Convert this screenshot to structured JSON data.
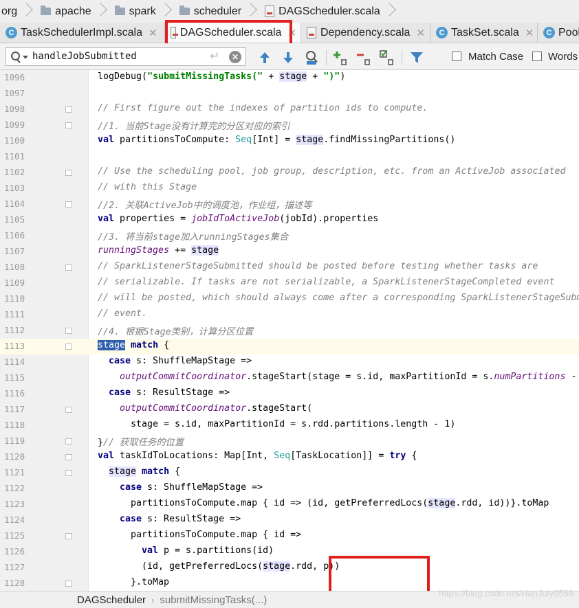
{
  "breadcrumb": [
    "org",
    "apache",
    "spark",
    "scheduler",
    "DAGScheduler.scala"
  ],
  "tabs": [
    {
      "label": "TaskSchedulerImpl.scala",
      "icon": "class-icon"
    },
    {
      "label": "DAGScheduler.scala",
      "icon": "scala-file-icon",
      "active": true
    },
    {
      "label": "Dependency.scala",
      "icon": "scala-file-icon"
    },
    {
      "label": "TaskSet.scala",
      "icon": "class-icon"
    },
    {
      "label": "Pool",
      "icon": "class-icon"
    }
  ],
  "search": {
    "value": "handleJobSubmitted",
    "enter_glyph": "↵",
    "clear_glyph": "✕",
    "match_case_label": "Match Case",
    "words_label": "Words"
  },
  "editor": {
    "lines": [
      {
        "n": "1096",
        "indent": 0,
        "tokens": [
          [
            "logDebug("
          ],
          [
            "\"submitMissingTasks(\"",
            "str"
          ],
          [
            " + "
          ],
          [
            "stage",
            "hl"
          ],
          [
            " + "
          ],
          [
            "\")\"",
            "str"
          ],
          [
            ")"
          ]
        ]
      },
      {
        "n": "1097",
        "indent": 0,
        "tokens": []
      },
      {
        "n": "1098",
        "indent": 0,
        "fold": true,
        "tokens": [
          [
            "// First figure out the indexes of partition ids to compute.",
            "cmt"
          ]
        ]
      },
      {
        "n": "1099",
        "indent": 0,
        "fold": true,
        "tokens": [
          [
            "//1. 当前Stage没有计算完的分区对应的索引",
            "cmt"
          ]
        ]
      },
      {
        "n": "1100",
        "indent": 0,
        "tokens": [
          [
            "val",
            "kw"
          ],
          [
            " partitionsToCompute: "
          ],
          [
            "Seq",
            "typ"
          ],
          [
            "[Int] = "
          ],
          [
            "stage",
            "hl"
          ],
          [
            ".findMissingPartitions()"
          ]
        ]
      },
      {
        "n": "1101",
        "indent": 0,
        "tokens": []
      },
      {
        "n": "1102",
        "indent": 0,
        "fold": true,
        "tokens": [
          [
            "// Use the scheduling pool, job group, description, etc. from an ActiveJob associated",
            "cmt"
          ]
        ]
      },
      {
        "n": "1103",
        "indent": 0,
        "tokens": [
          [
            "// with this Stage",
            "cmt"
          ]
        ]
      },
      {
        "n": "1104",
        "indent": 0,
        "fold": true,
        "tokens": [
          [
            "//2. 关联ActiveJob中的调度池，作业组，描述等",
            "cmt"
          ]
        ]
      },
      {
        "n": "1105",
        "indent": 0,
        "tokens": [
          [
            "val",
            "kw"
          ],
          [
            " properties = "
          ],
          [
            "jobIdToActiveJob",
            "fld"
          ],
          [
            "(jobId).properties"
          ]
        ]
      },
      {
        "n": "1106",
        "indent": 0,
        "tokens": [
          [
            "//3. 将当前stage加入runningStages集合",
            "cmt"
          ]
        ]
      },
      {
        "n": "1107",
        "indent": 0,
        "tokens": [
          [
            "runningStages",
            "fld"
          ],
          [
            " += "
          ],
          [
            "stage",
            "hl"
          ]
        ]
      },
      {
        "n": "1108",
        "indent": 0,
        "fold": true,
        "tokens": [
          [
            "// SparkListenerStageSubmitted should be posted before testing whether tasks are",
            "cmt"
          ]
        ]
      },
      {
        "n": "1109",
        "indent": 0,
        "tokens": [
          [
            "// serializable. If tasks are not serializable, a SparkListenerStageCompleted event",
            "cmt"
          ]
        ]
      },
      {
        "n": "1110",
        "indent": 0,
        "tokens": [
          [
            "// will be posted, which should always come after a corresponding SparkListenerStageSubm",
            "cmt"
          ]
        ]
      },
      {
        "n": "1111",
        "indent": 0,
        "tokens": [
          [
            "// event.",
            "cmt"
          ]
        ]
      },
      {
        "n": "1112",
        "indent": 0,
        "fold": true,
        "tokens": [
          [
            "//4. 根据Stage类别，计算分区位置",
            "cmt"
          ]
        ]
      },
      {
        "n": "1113",
        "indent": 0,
        "fold": true,
        "current": true,
        "tokens": [
          [
            "stage",
            "hl-sel"
          ],
          [
            " "
          ],
          [
            "match",
            "kw"
          ],
          [
            " {"
          ]
        ]
      },
      {
        "n": "1114",
        "indent": 1,
        "tokens": [
          [
            "case",
            "kw"
          ],
          [
            " s: ShuffleMapStage =>"
          ]
        ]
      },
      {
        "n": "1115",
        "indent": 2,
        "tokens": [
          [
            "outputCommitCoordinator",
            "fld"
          ],
          [
            ".stageStart(stage = s.id, maxPartitionId = s."
          ],
          [
            "numPartitions",
            "fld"
          ],
          [
            " -"
          ]
        ]
      },
      {
        "n": "1116",
        "indent": 1,
        "tokens": [
          [
            "case",
            "kw"
          ],
          [
            " s: ResultStage =>"
          ]
        ]
      },
      {
        "n": "1117",
        "indent": 2,
        "fold": true,
        "tokens": [
          [
            "outputCommitCoordinator",
            "fld"
          ],
          [
            ".stageStart("
          ]
        ]
      },
      {
        "n": "1118",
        "indent": 3,
        "tokens": [
          [
            "stage = s.id, maxPartitionId = s.rdd.partitions.length - 1)"
          ]
        ]
      },
      {
        "n": "1119",
        "indent": 0,
        "fold": true,
        "tokens": [
          [
            "}"
          ],
          [
            "// 获取任务的位置",
            "cmt"
          ]
        ]
      },
      {
        "n": "1120",
        "indent": 0,
        "fold": true,
        "tokens": [
          [
            "val",
            "kw"
          ],
          [
            " taskIdToLocations: Map[Int, "
          ],
          [
            "Seq",
            "typ"
          ],
          [
            "[TaskLocation]] = "
          ],
          [
            "try",
            "kw"
          ],
          [
            " {"
          ]
        ]
      },
      {
        "n": "1121",
        "indent": 1,
        "fold": true,
        "tokens": [
          [
            "stage",
            "hl"
          ],
          [
            " "
          ],
          [
            "match",
            "kw"
          ],
          [
            " {"
          ]
        ]
      },
      {
        "n": "1122",
        "indent": 2,
        "tokens": [
          [
            "case",
            "kw"
          ],
          [
            " s: ShuffleMapStage =>"
          ]
        ]
      },
      {
        "n": "1123",
        "indent": 3,
        "tokens": [
          [
            "partitionsToCompute.map { id => (id, getPreferredLocs("
          ],
          [
            "stage",
            "hl"
          ],
          [
            ".rdd, id))}.toMap"
          ]
        ]
      },
      {
        "n": "1124",
        "indent": 2,
        "tokens": [
          [
            "case",
            "kw"
          ],
          [
            " s: ResultStage =>"
          ]
        ]
      },
      {
        "n": "1125",
        "indent": 3,
        "fold": true,
        "tokens": [
          [
            "partitionsToCompute.map { id =>"
          ]
        ]
      },
      {
        "n": "1126",
        "indent": 4,
        "tokens": [
          [
            "val",
            "kw"
          ],
          [
            " p = s.partitions(id)"
          ]
        ]
      },
      {
        "n": "1127",
        "indent": 4,
        "tokens": [
          [
            "(id, getPreferredLocs("
          ],
          [
            "stage",
            "hl"
          ],
          [
            ".rdd, p))"
          ]
        ]
      },
      {
        "n": "1128",
        "indent": 3,
        "fold": true,
        "tokens": [
          [
            "}.toMap"
          ]
        ]
      }
    ]
  },
  "status": {
    "crumb_class": "DAGScheduler",
    "crumb_method": "submitMissingTasks(...)",
    "watermark": "https://blog.csdn.net/HanJuly9569"
  },
  "colors": {
    "annotation_box": "#e0201c",
    "current_line": "#fefbe9",
    "selection": "#2c5fae",
    "keyword": "#000080",
    "string": "#008000",
    "comment": "#808080"
  }
}
